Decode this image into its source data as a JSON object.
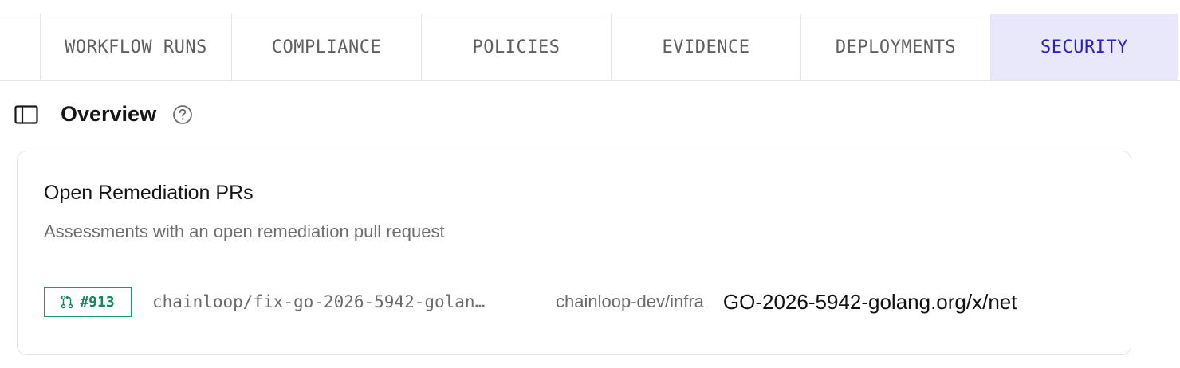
{
  "tabs": [
    {
      "label": "WORKFLOW RUNS"
    },
    {
      "label": "COMPLIANCE"
    },
    {
      "label": "POLICIES"
    },
    {
      "label": "EVIDENCE"
    },
    {
      "label": "DEPLOYMENTS"
    },
    {
      "label": "SECURITY",
      "active": true
    }
  ],
  "overview": {
    "title": "Overview",
    "sidebar_icon": "sidebar-panel-icon",
    "help_icon": "question-circle-icon"
  },
  "card": {
    "title": "Open Remediation PRs",
    "description": "Assessments with an open remediation pull request",
    "prs": [
      {
        "number": "#913",
        "icon": "git-pull-request-icon",
        "branch": "chainloop/fix-go-2026-5942-golan…",
        "repo": "chainloop-dev/infra",
        "vulnerability": "GO-2026-5942-golang.org/x/net"
      }
    ]
  },
  "colors": {
    "active_tab_bg": "#e9e8fb",
    "active_tab_text": "#2b1fc2",
    "pr_badge": "#1b9a6e"
  }
}
